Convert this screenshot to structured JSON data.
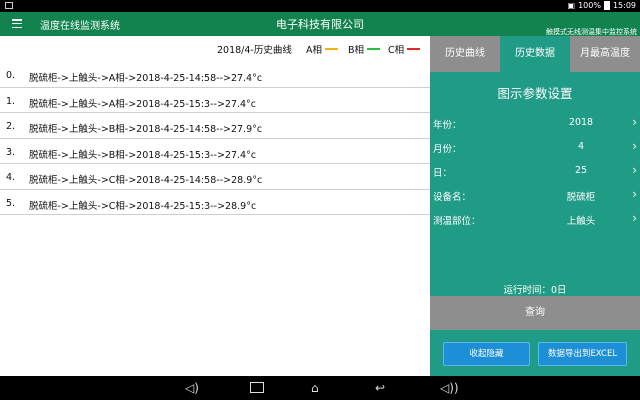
{
  "status": {
    "battery": "100%",
    "time": "15:09"
  },
  "app": {
    "title": "温度在线监测系统",
    "company": "电子科技有限公司",
    "subtitle": "触摸式无线测温集中监控系统"
  },
  "chart_header": {
    "title": "2018/4-历史曲线",
    "legend": [
      {
        "label": "A相",
        "color": "#f2b21c"
      },
      {
        "label": "B相",
        "color": "#2fbf3f"
      },
      {
        "label": "C相",
        "color": "#e02a2a"
      }
    ]
  },
  "records": [
    {
      "index": "0.",
      "text": "脱硫柜->上触头->A相->2018-4-25-14:58-->27.4°c"
    },
    {
      "index": "1.",
      "text": "脱硫柜->上触头->A相->2018-4-25-15:3-->27.4°c"
    },
    {
      "index": "2.",
      "text": "脱硫柜->上触头->B相->2018-4-25-14:58-->27.9°c"
    },
    {
      "index": "3.",
      "text": "脱硫柜->上触头->B相->2018-4-25-15:3-->27.4°c"
    },
    {
      "index": "4.",
      "text": "脱硫柜->上触头->C相->2018-4-25-14:58-->28.9°c"
    },
    {
      "index": "5.",
      "text": "脱硫柜->上触头->C相->2018-4-25-15:3-->28.9°c"
    }
  ],
  "tabs": [
    {
      "label": "历史曲线",
      "active": false
    },
    {
      "label": "历史数据",
      "active": true
    },
    {
      "label": "月最高温度",
      "active": false
    }
  ],
  "panel": {
    "title": "图示参数设置",
    "params": [
      {
        "label": "年份：",
        "value": "2018"
      },
      {
        "label": "月份：",
        "value": "4"
      },
      {
        "label": "日：",
        "value": "25"
      },
      {
        "label": "设备名：",
        "value": "脱硫柜"
      },
      {
        "label": "测温部位：",
        "value": "上触头"
      }
    ],
    "runtime": "运行时间：0日",
    "query_label": "查询",
    "collapse_label": "收起隐藏",
    "export_label": "数据导出到EXCEL"
  },
  "icons": {
    "menu": "hamburger-menu-icon",
    "param_arrow": "chevron-right-icon",
    "nav": [
      "volume-icon",
      "recent-apps-icon",
      "home-icon",
      "back-icon",
      "volume-up-icon"
    ]
  },
  "colors": {
    "app_bar": "#12834f",
    "panel": "#1f9b86",
    "inactive_tab": "#8e8e8e",
    "button_blue": "#1d8fd6"
  }
}
